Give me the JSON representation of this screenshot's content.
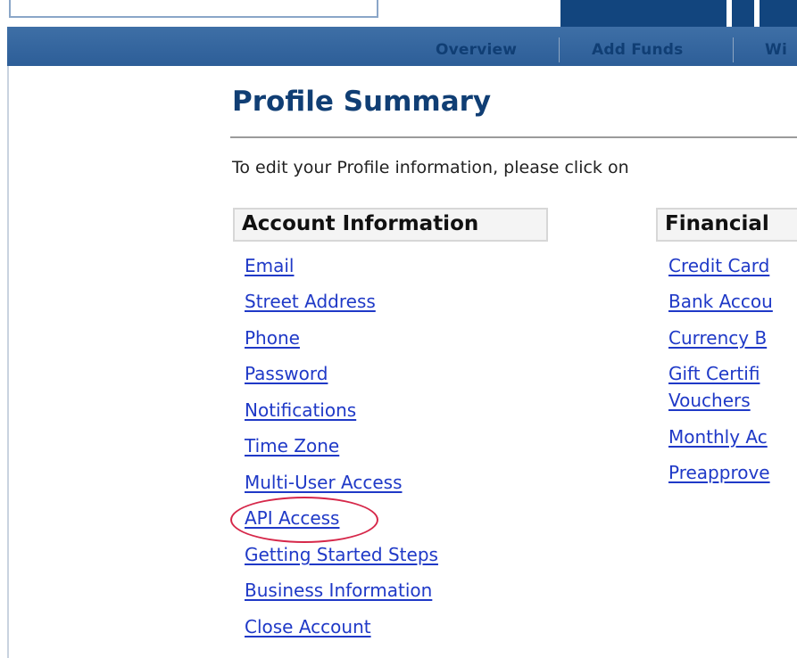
{
  "subnav": {
    "items": [
      "Overview",
      "Add Funds",
      "Wi"
    ]
  },
  "page": {
    "title": "Profile Summary",
    "instruction": "To edit your Profile information, please click on"
  },
  "sections": {
    "account": {
      "header": "Account Information",
      "links": [
        "Email",
        "Street Address",
        "Phone",
        "Password",
        "Notifications",
        "Time Zone",
        "Multi-User Access",
        "API Access",
        "Getting Started Steps",
        "Business Information",
        "Close Account"
      ]
    },
    "financial": {
      "header": "Financial",
      "links": [
        "Credit Card",
        "Bank Accou",
        "Currency B",
        "Gift Certifi",
        "Vouchers",
        "Monthly Ac",
        "Preapprove"
      ]
    }
  },
  "highlighted_link": "API Access",
  "colors": {
    "nav_blue": "#2d5e98",
    "title_blue": "#103e74",
    "link_blue": "#1f39c7",
    "highlight_red": "#d6284a"
  }
}
